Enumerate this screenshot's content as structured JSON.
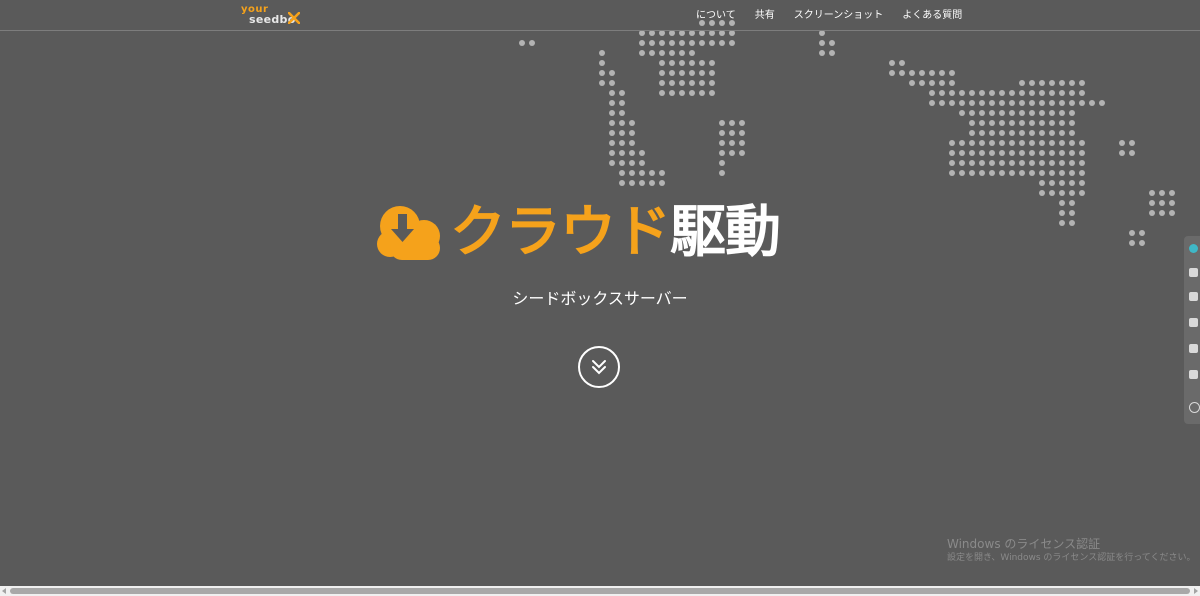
{
  "brand": {
    "logo_top": "your",
    "logo_bottom": "seedbo",
    "accent": "#f5a21b"
  },
  "nav": {
    "items": [
      "について",
      "共有",
      "スクリーンショット",
      "よくある質問"
    ]
  },
  "hero": {
    "title_orange": "クラウド",
    "title_white": "駆動",
    "subtitle": "シードボックスサーバー"
  },
  "icons": {
    "cloud": "cloud-download-icon",
    "scroll": "chevron-double-down-icon"
  },
  "watermark": {
    "title": "Windows のライセンス認証",
    "subtitle": "設定を開き、Windows のライセンス認証を行ってください。"
  },
  "colors": {
    "background": "#5a5a5a",
    "dots": "#b3b3b3",
    "text": "#ffffff"
  }
}
